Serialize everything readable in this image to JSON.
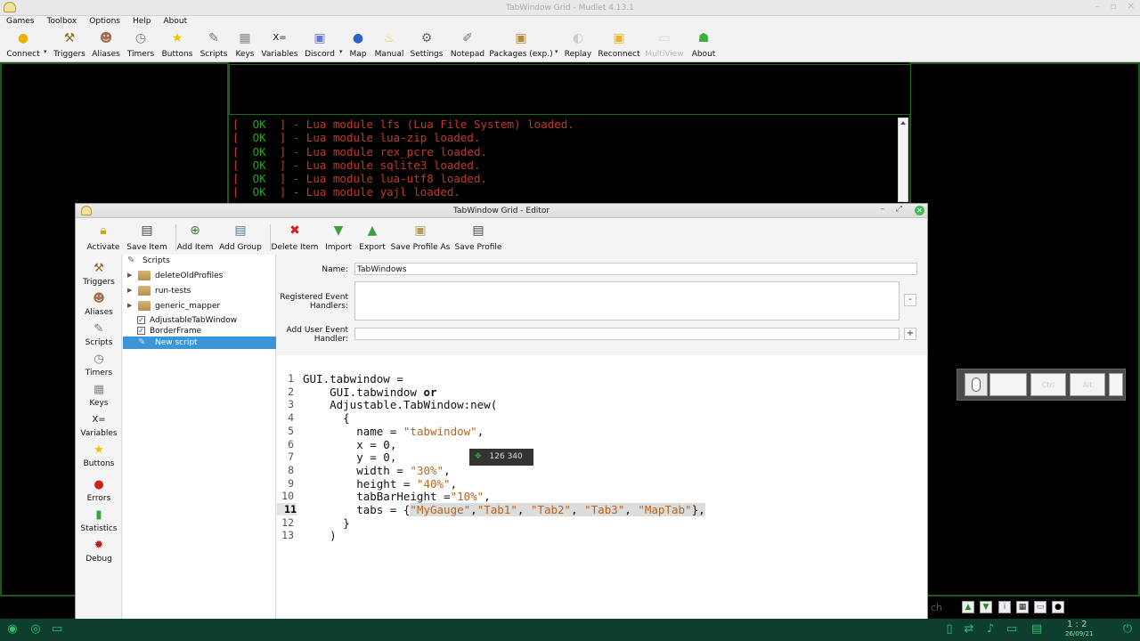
{
  "main_window": {
    "title": "TabWindow Grid - Mudlet 4.13.1",
    "menu": [
      "Games",
      "Toolbox",
      "Options",
      "Help",
      "About"
    ],
    "toolbar": [
      {
        "label": "Connect",
        "icon": "lightbulb-icon"
      },
      {
        "label": "Triggers",
        "icon": "triggers-icon"
      },
      {
        "label": "Aliases",
        "icon": "aliases-icon"
      },
      {
        "label": "Timers",
        "icon": "timers-icon"
      },
      {
        "label": "Buttons",
        "icon": "star-icon"
      },
      {
        "label": "Scripts",
        "icon": "scripts-icon"
      },
      {
        "label": "Keys",
        "icon": "keyboard-icon"
      },
      {
        "label": "Variables",
        "icon": "variables-icon"
      },
      {
        "label": "Discord",
        "icon": "discord-icon"
      },
      {
        "label": "Map",
        "icon": "globe-icon"
      },
      {
        "label": "Manual",
        "icon": "bulb-icon"
      },
      {
        "label": "Settings",
        "icon": "wrench-icon"
      },
      {
        "label": "Notepad",
        "icon": "notepad-icon"
      },
      {
        "label": "Packages (exp.)",
        "icon": "package-icon"
      },
      {
        "label": "Replay",
        "icon": "replay-icon"
      },
      {
        "label": "Reconnect",
        "icon": "reconnect-icon"
      },
      {
        "label": "MultiView",
        "icon": "multiview-icon",
        "disabled": true
      },
      {
        "label": "About",
        "icon": "about-icon"
      }
    ]
  },
  "console": {
    "lines": [
      {
        "status": "OK",
        "text": "- Lua module lfs (Lua File System) loaded."
      },
      {
        "status": "OK",
        "text": "- Lua module lua-zip loaded."
      },
      {
        "status": "OK",
        "text": "- Lua module rex_pcre loaded."
      },
      {
        "status": "OK",
        "text": "- Lua module sqlite3 loaded."
      },
      {
        "status": "OK",
        "text": "- Lua module lua-utf8 loaded."
      },
      {
        "status": "OK",
        "text": "- Lua module yajl loaded."
      }
    ]
  },
  "editor": {
    "title": "TabWindow Grid - Editor",
    "toolbar": [
      {
        "label": "Activate",
        "icon": "lock-icon"
      },
      {
        "label": "Save Item",
        "icon": "save-item-icon"
      },
      {
        "label": "Add Item",
        "icon": "add-item-icon"
      },
      {
        "label": "Add Group",
        "icon": "add-group-icon"
      },
      {
        "label": "Delete Item",
        "icon": "delete-icon"
      },
      {
        "label": "Import",
        "icon": "import-icon"
      },
      {
        "label": "Export",
        "icon": "export-icon"
      },
      {
        "label": "Save Profile As",
        "icon": "save-profile-as-icon"
      },
      {
        "label": "Save Profile",
        "icon": "save-profile-icon"
      }
    ],
    "sidebar": [
      {
        "label": "Triggers",
        "icon": "triggers-icon"
      },
      {
        "label": "Aliases",
        "icon": "aliases-icon"
      },
      {
        "label": "Scripts",
        "icon": "scripts-icon"
      },
      {
        "label": "Timers",
        "icon": "timers-icon"
      },
      {
        "label": "Keys",
        "icon": "keyboard-icon"
      },
      {
        "label": "Variables",
        "icon": "variables-icon"
      },
      {
        "label": "Buttons",
        "icon": "star-icon"
      },
      {
        "label": "Errors",
        "icon": "error-icon"
      },
      {
        "label": "Statistics",
        "icon": "statistics-icon"
      },
      {
        "label": "Debug",
        "icon": "bug-icon"
      }
    ],
    "tree": {
      "root": "Scripts",
      "items": [
        {
          "label": "deleteOldProfiles",
          "type": "folder"
        },
        {
          "label": "run-tests",
          "type": "folder"
        },
        {
          "label": "generic_mapper",
          "type": "folder"
        },
        {
          "label": "AdjustableTabWindow",
          "type": "checked"
        },
        {
          "label": "BorderFrame",
          "type": "checked"
        },
        {
          "label": "New script",
          "type": "script",
          "selected": true
        }
      ]
    },
    "form": {
      "name_label": "Name:",
      "name_value": "TabWindows",
      "registered_label_1": "Registered Event",
      "registered_label_2": "Handlers:",
      "remove_button": "-",
      "add_handler_label_1": "Add User Event",
      "add_handler_label_2": "Handler:",
      "add_button": "+"
    },
    "code": {
      "current_line": 11,
      "lines": [
        "GUI.tabwindow =",
        "    GUI.tabwindow or",
        "    Adjustable.TabWindow:new(",
        "      {",
        "        name = \"tabwindow\",",
        "        x = 0,",
        "        y = 0,",
        "        width = \"30%\",",
        "        height = \"40%\",",
        "        tabBarHeight =\"10%\",",
        "        tabs = {\"MyGauge\",\"Tab1\", \"Tab2\", \"Tab3\", \"MapTab\"},",
        "      }",
        "    )"
      ]
    },
    "tooltip": "126 340"
  },
  "keyboard_widget": {
    "keys": [
      "",
      "",
      "Ctrl",
      "Alt",
      ""
    ]
  },
  "taskbar": {
    "search_fragment": "ch",
    "clock_fragment": "1 : 2",
    "date_fragment": "26/09/21"
  },
  "colors": {
    "console_ok": "#1fa81f",
    "console_text": "#c0392b",
    "selection": "#3a96d8",
    "frame_green": "#1c5a1c",
    "taskbar": "#0e3f2e"
  }
}
